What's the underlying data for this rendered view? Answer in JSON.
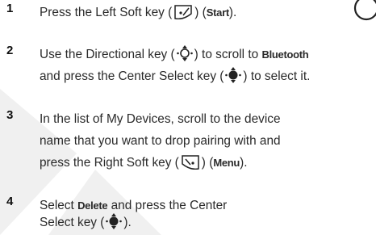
{
  "colors": {
    "text": "#2a2a2a",
    "number": "#111111",
    "watermark": "#ececec"
  },
  "steps": [
    {
      "number": "1",
      "t1": "Press the Left Soft key (",
      "t2": ") (",
      "b1": "Start",
      "t3": ")."
    },
    {
      "number": "2",
      "t1": "Use the Directional key (",
      "t2": ") to scroll to ",
      "b1": "Bluetooth",
      "t3": "and press the Center Select key (",
      "t4": ") to select it."
    },
    {
      "number": "3",
      "t1": "In the list of My Devices, scroll to the device",
      "t2": "name that you want to drop pairing with and",
      "t3": "press the Right Soft key (",
      "t4": ") (",
      "b1": "Menu",
      "t5": ")."
    },
    {
      "number": "4",
      "t1": "Select ",
      "b1": "Delete",
      "t2": " and press the Center",
      "t3": "Select key (",
      "t4": ")."
    }
  ],
  "icons": {
    "left_soft_key": "left-soft-key-icon",
    "directional_key": "directional-key-icon",
    "center_select_key": "center-select-key-icon",
    "right_soft_key": "right-soft-key-icon"
  }
}
